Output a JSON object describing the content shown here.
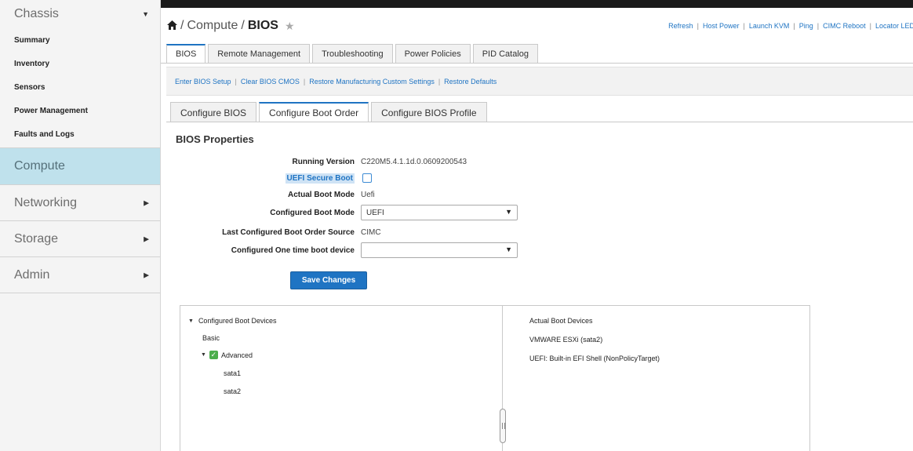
{
  "sidebar": {
    "chassis": {
      "label": "Chassis",
      "icon": "chevron-down-icon"
    },
    "chassis_items": [
      "Summary",
      "Inventory",
      "Sensors",
      "Power Management",
      "Faults and Logs"
    ],
    "compute": {
      "label": "Compute"
    },
    "networking": {
      "label": "Networking",
      "icon": "chevron-right-icon"
    },
    "storage": {
      "label": "Storage",
      "icon": "chevron-right-icon"
    },
    "admin": {
      "label": "Admin",
      "icon": "chevron-right-icon"
    }
  },
  "breadcrumb": {
    "home_icon": "home-icon",
    "sep": "/",
    "parent": "Compute",
    "current": "BIOS",
    "star_icon": "star-icon"
  },
  "toolbar": {
    "links": [
      "Refresh",
      "Host Power",
      "Launch KVM",
      "Ping",
      "CIMC Reboot",
      "Locator LED"
    ]
  },
  "main_tabs": [
    "BIOS",
    "Remote Management",
    "Troubleshooting",
    "Power Policies",
    "PID Catalog"
  ],
  "actions": [
    "Enter BIOS Setup",
    "Clear BIOS CMOS",
    "Restore Manufacturing Custom Settings",
    "Restore Defaults"
  ],
  "sub_tabs": [
    "Configure BIOS",
    "Configure Boot Order",
    "Configure BIOS Profile"
  ],
  "bios_properties": {
    "title": "BIOS Properties",
    "running_version_label": "Running Version",
    "running_version_value": "C220M5.4.1.1d.0.0609200543",
    "uefi_secure_boot_label": "UEFI Secure Boot",
    "actual_boot_mode_label": "Actual Boot Mode",
    "actual_boot_mode_value": "Uefi",
    "configured_boot_mode_label": "Configured Boot Mode",
    "configured_boot_mode_value": "UEFI",
    "last_source_label": "Last Configured Boot Order Source",
    "last_source_value": "CIMC",
    "one_time_label": "Configured One time boot device",
    "one_time_value": "",
    "save_label": "Save Changes"
  },
  "configured_devices": {
    "title": "Configured Boot Devices",
    "basic": "Basic",
    "advanced": "Advanced",
    "items": [
      "sata1",
      "sata2"
    ]
  },
  "actual_devices": {
    "title": "Actual Boot Devices",
    "items": [
      "VMWARE ESXi (sata2)",
      "UEFI: Built-in EFI Shell (NonPolicyTarget)"
    ]
  },
  "colors": {
    "accent": "#1f74c3",
    "compute_bg": "#bfe1ec",
    "check_green": "#4cae4c"
  }
}
